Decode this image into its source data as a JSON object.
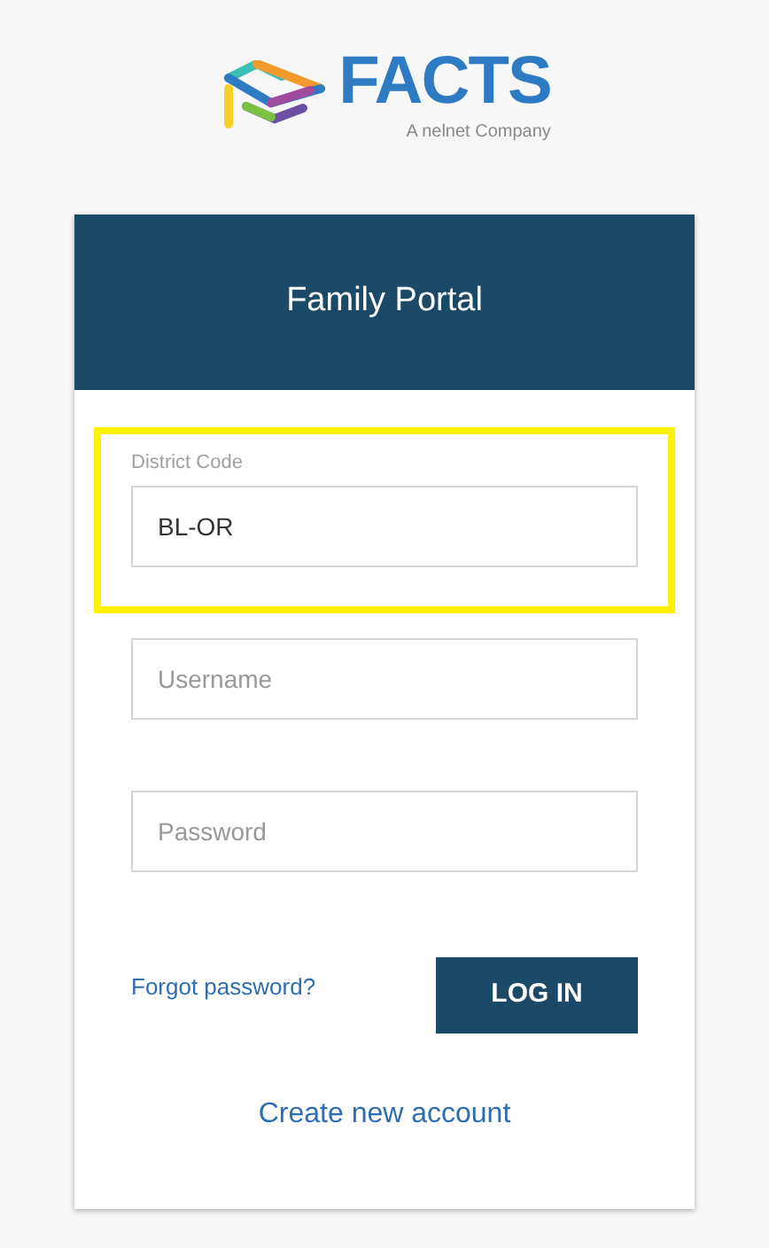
{
  "logo": {
    "brand": "FACTS",
    "tagline": "A nelnet Company"
  },
  "card": {
    "title": "Family Portal"
  },
  "fields": [
    {
      "label": "District Code",
      "value": "BL-OR",
      "highlighted": true
    },
    {
      "placeholder": "Username",
      "highlighted": false
    },
    {
      "placeholder": "Password",
      "highlighted": false
    }
  ],
  "forgot_link": "Forgot password?",
  "login_button": "LOG IN",
  "create_link": "Create new account"
}
